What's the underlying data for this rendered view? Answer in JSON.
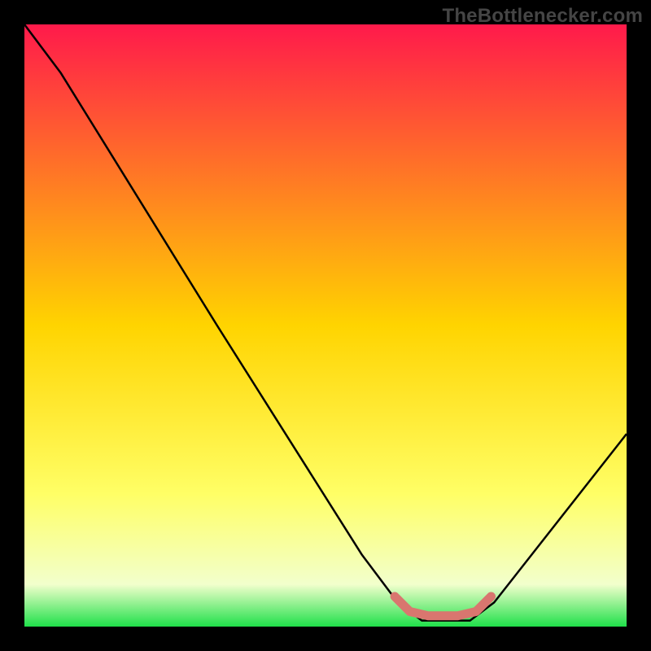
{
  "watermark": "TheBottlenecker.com",
  "chart_data": {
    "type": "line",
    "title": "",
    "xlabel": "",
    "ylabel": "",
    "xlim": [
      0,
      100
    ],
    "ylim": [
      0,
      100
    ],
    "gradient_stops": [
      {
        "offset": 0,
        "color": "#ff1a4b"
      },
      {
        "offset": 50,
        "color": "#ffd400"
      },
      {
        "offset": 78,
        "color": "#ffff66"
      },
      {
        "offset": 93,
        "color": "#f2ffcc"
      },
      {
        "offset": 100,
        "color": "#20e04a"
      }
    ],
    "black_curve": [
      {
        "x": 0,
        "y": 100
      },
      {
        "x": 6,
        "y": 92
      },
      {
        "x": 32,
        "y": 50
      },
      {
        "x": 56,
        "y": 12
      },
      {
        "x": 62,
        "y": 4
      },
      {
        "x": 66,
        "y": 1
      },
      {
        "x": 74,
        "y": 1
      },
      {
        "x": 78,
        "y": 4
      },
      {
        "x": 100,
        "y": 32
      }
    ],
    "highlight_segment": {
      "color": "#d9766f",
      "points": [
        {
          "x": 61.5,
          "y": 5
        },
        {
          "x": 64,
          "y": 2.5
        },
        {
          "x": 67,
          "y": 1.8
        },
        {
          "x": 72,
          "y": 1.8
        },
        {
          "x": 75,
          "y": 2.5
        },
        {
          "x": 77.5,
          "y": 5
        }
      ]
    }
  }
}
